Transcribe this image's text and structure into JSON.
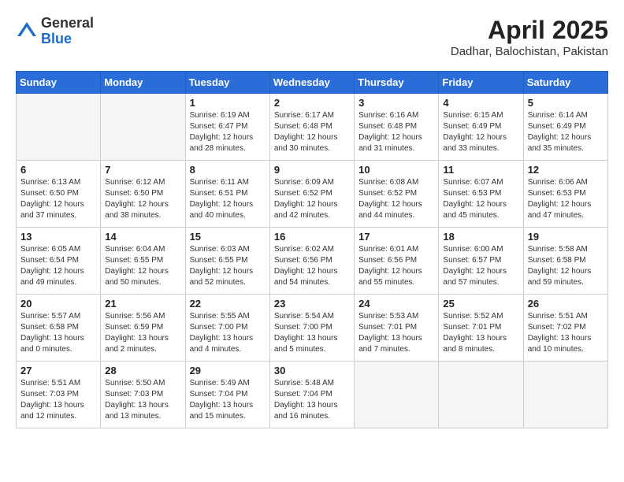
{
  "logo": {
    "general": "General",
    "blue": "Blue"
  },
  "title": "April 2025",
  "location": "Dadhar, Balochistan, Pakistan",
  "weekdays": [
    "Sunday",
    "Monday",
    "Tuesday",
    "Wednesday",
    "Thursday",
    "Friday",
    "Saturday"
  ],
  "weeks": [
    [
      {
        "day": null,
        "info": null
      },
      {
        "day": null,
        "info": null
      },
      {
        "day": "1",
        "info": "Sunrise: 6:19 AM\nSunset: 6:47 PM\nDaylight: 12 hours\nand 28 minutes."
      },
      {
        "day": "2",
        "info": "Sunrise: 6:17 AM\nSunset: 6:48 PM\nDaylight: 12 hours\nand 30 minutes."
      },
      {
        "day": "3",
        "info": "Sunrise: 6:16 AM\nSunset: 6:48 PM\nDaylight: 12 hours\nand 31 minutes."
      },
      {
        "day": "4",
        "info": "Sunrise: 6:15 AM\nSunset: 6:49 PM\nDaylight: 12 hours\nand 33 minutes."
      },
      {
        "day": "5",
        "info": "Sunrise: 6:14 AM\nSunset: 6:49 PM\nDaylight: 12 hours\nand 35 minutes."
      }
    ],
    [
      {
        "day": "6",
        "info": "Sunrise: 6:13 AM\nSunset: 6:50 PM\nDaylight: 12 hours\nand 37 minutes."
      },
      {
        "day": "7",
        "info": "Sunrise: 6:12 AM\nSunset: 6:50 PM\nDaylight: 12 hours\nand 38 minutes."
      },
      {
        "day": "8",
        "info": "Sunrise: 6:11 AM\nSunset: 6:51 PM\nDaylight: 12 hours\nand 40 minutes."
      },
      {
        "day": "9",
        "info": "Sunrise: 6:09 AM\nSunset: 6:52 PM\nDaylight: 12 hours\nand 42 minutes."
      },
      {
        "day": "10",
        "info": "Sunrise: 6:08 AM\nSunset: 6:52 PM\nDaylight: 12 hours\nand 44 minutes."
      },
      {
        "day": "11",
        "info": "Sunrise: 6:07 AM\nSunset: 6:53 PM\nDaylight: 12 hours\nand 45 minutes."
      },
      {
        "day": "12",
        "info": "Sunrise: 6:06 AM\nSunset: 6:53 PM\nDaylight: 12 hours\nand 47 minutes."
      }
    ],
    [
      {
        "day": "13",
        "info": "Sunrise: 6:05 AM\nSunset: 6:54 PM\nDaylight: 12 hours\nand 49 minutes."
      },
      {
        "day": "14",
        "info": "Sunrise: 6:04 AM\nSunset: 6:55 PM\nDaylight: 12 hours\nand 50 minutes."
      },
      {
        "day": "15",
        "info": "Sunrise: 6:03 AM\nSunset: 6:55 PM\nDaylight: 12 hours\nand 52 minutes."
      },
      {
        "day": "16",
        "info": "Sunrise: 6:02 AM\nSunset: 6:56 PM\nDaylight: 12 hours\nand 54 minutes."
      },
      {
        "day": "17",
        "info": "Sunrise: 6:01 AM\nSunset: 6:56 PM\nDaylight: 12 hours\nand 55 minutes."
      },
      {
        "day": "18",
        "info": "Sunrise: 6:00 AM\nSunset: 6:57 PM\nDaylight: 12 hours\nand 57 minutes."
      },
      {
        "day": "19",
        "info": "Sunrise: 5:58 AM\nSunset: 6:58 PM\nDaylight: 12 hours\nand 59 minutes."
      }
    ],
    [
      {
        "day": "20",
        "info": "Sunrise: 5:57 AM\nSunset: 6:58 PM\nDaylight: 13 hours\nand 0 minutes."
      },
      {
        "day": "21",
        "info": "Sunrise: 5:56 AM\nSunset: 6:59 PM\nDaylight: 13 hours\nand 2 minutes."
      },
      {
        "day": "22",
        "info": "Sunrise: 5:55 AM\nSunset: 7:00 PM\nDaylight: 13 hours\nand 4 minutes."
      },
      {
        "day": "23",
        "info": "Sunrise: 5:54 AM\nSunset: 7:00 PM\nDaylight: 13 hours\nand 5 minutes."
      },
      {
        "day": "24",
        "info": "Sunrise: 5:53 AM\nSunset: 7:01 PM\nDaylight: 13 hours\nand 7 minutes."
      },
      {
        "day": "25",
        "info": "Sunrise: 5:52 AM\nSunset: 7:01 PM\nDaylight: 13 hours\nand 8 minutes."
      },
      {
        "day": "26",
        "info": "Sunrise: 5:51 AM\nSunset: 7:02 PM\nDaylight: 13 hours\nand 10 minutes."
      }
    ],
    [
      {
        "day": "27",
        "info": "Sunrise: 5:51 AM\nSunset: 7:03 PM\nDaylight: 13 hours\nand 12 minutes."
      },
      {
        "day": "28",
        "info": "Sunrise: 5:50 AM\nSunset: 7:03 PM\nDaylight: 13 hours\nand 13 minutes."
      },
      {
        "day": "29",
        "info": "Sunrise: 5:49 AM\nSunset: 7:04 PM\nDaylight: 13 hours\nand 15 minutes."
      },
      {
        "day": "30",
        "info": "Sunrise: 5:48 AM\nSunset: 7:04 PM\nDaylight: 13 hours\nand 16 minutes."
      },
      {
        "day": null,
        "info": null
      },
      {
        "day": null,
        "info": null
      },
      {
        "day": null,
        "info": null
      }
    ]
  ]
}
